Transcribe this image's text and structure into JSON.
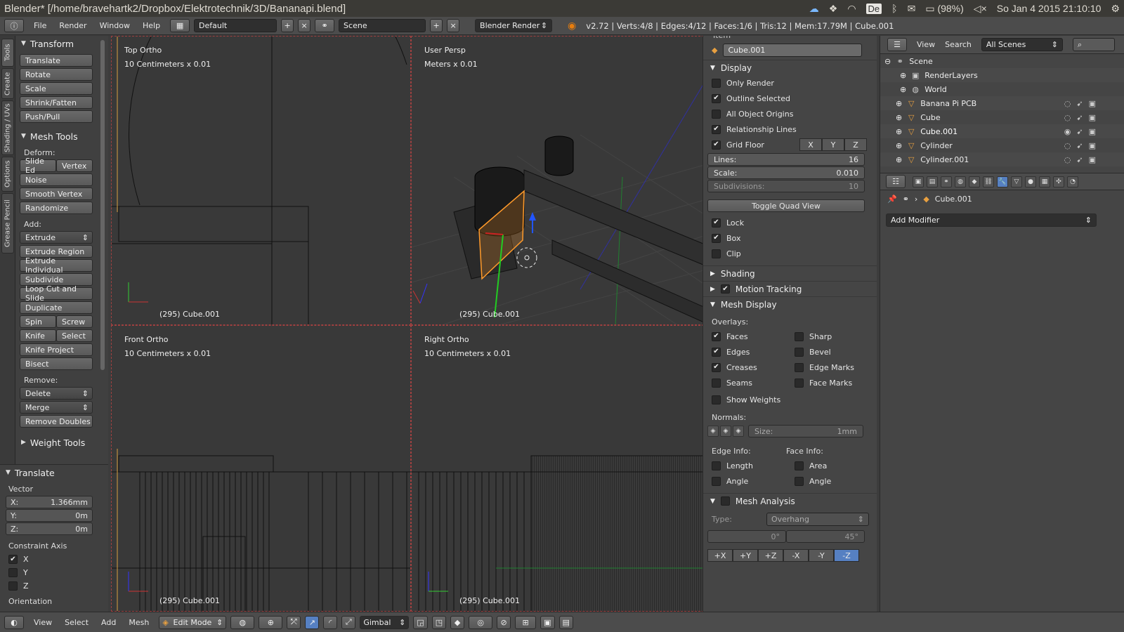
{
  "system": {
    "title": "Blender* [/home/bravehartk2/Dropbox/Elektrotechnik/3D/Bananapi.blend]",
    "keyboard": "De",
    "battery": "(98%)",
    "datetime": "So Jan 4 2015 21:10:10"
  },
  "info_header": {
    "menus": [
      "File",
      "Render",
      "Window",
      "Help"
    ],
    "layout": "Default",
    "scene": "Scene",
    "engine": "Blender Render",
    "stats": "v2.72 | Verts:4/8 | Edges:4/12 | Faces:1/6 | Tris:12 | Mem:17.79M | Cube.001"
  },
  "tool_tabs": [
    "Tools",
    "Create",
    "Shading / UVs",
    "Options",
    "Grease Pencil"
  ],
  "tools": {
    "transform_title": "Transform",
    "transform": [
      "Translate",
      "Rotate",
      "Scale",
      "Shrink/Fatten",
      "Push/Pull"
    ],
    "mesh_tools_title": "Mesh Tools",
    "deform_label": "Deform:",
    "slide_edge": "Slide Ed",
    "vertex": "Vertex",
    "deform": [
      "Noise",
      "Smooth Vertex",
      "Randomize"
    ],
    "add_label": "Add:",
    "extrude": "Extrude",
    "add": [
      "Extrude Region",
      "Extrude Individual",
      "Subdivide",
      "Loop Cut and Slide",
      "Duplicate"
    ],
    "spin": "Spin",
    "screw": "Screw",
    "knife": "Knife",
    "select": "Select",
    "add2": [
      "Knife Project",
      "Bisect"
    ],
    "remove_label": "Remove:",
    "delete": "Delete",
    "merge": "Merge",
    "remove_doubles": "Remove Doubles",
    "weight_tools": "Weight Tools"
  },
  "redo": {
    "title": "Translate",
    "vector_label": "Vector",
    "x": {
      "label": "X:",
      "value": "1.366mm"
    },
    "y": {
      "label": "Y:",
      "value": "0m"
    },
    "z": {
      "label": "Z:",
      "value": "0m"
    },
    "constraint_label": "Constraint Axis",
    "cx": "X",
    "cy": "Y",
    "cz": "Z",
    "orientation": "Orientation"
  },
  "viewports": {
    "top": {
      "name": "Top Ortho",
      "scale": "10 Centimeters x 0.01",
      "object": "(295) Cube.001"
    },
    "persp": {
      "name": "User Persp",
      "scale": "Meters x 0.01",
      "object": "(295) Cube.001"
    },
    "front": {
      "name": "Front Ortho",
      "scale": "10 Centimeters x 0.01",
      "object": "(295) Cube.001"
    },
    "right": {
      "name": "Right Ortho",
      "scale": "10 Centimeters x 0.01",
      "object": "(295) Cube.001"
    }
  },
  "npanel": {
    "item_title": "Item",
    "object_name": "Cube.001",
    "display_title": "Display",
    "only_render": "Only Render",
    "outline_selected": "Outline Selected",
    "all_object_origins": "All Object Origins",
    "relationship_lines": "Relationship Lines",
    "grid_floor": "Grid Floor",
    "x": "X",
    "y": "Y",
    "z": "Z",
    "lines_label": "Lines:",
    "lines_value": "16",
    "scale_label": "Scale:",
    "scale_value": "0.010",
    "subdiv_label": "Subdivisions:",
    "subdiv_value": "10",
    "toggle_quad": "Toggle Quad View",
    "lock": "Lock",
    "box": "Box",
    "clip": "Clip",
    "shading": "Shading",
    "motion_tracking": "Motion Tracking",
    "mesh_display": "Mesh Display",
    "overlays": "Overlays:",
    "faces": "Faces",
    "sharp": "Sharp",
    "edges": "Edges",
    "bevel": "Bevel",
    "creases": "Creases",
    "edge_marks": "Edge Marks",
    "seams": "Seams",
    "face_marks": "Face Marks",
    "show_weights": "Show Weights",
    "normals": "Normals:",
    "size_label": "Size:",
    "size_value": "1mm",
    "edge_info": "Edge Info:",
    "face_info": "Face Info:",
    "length": "Length",
    "area": "Area",
    "angle": "Angle",
    "angle2": "Angle",
    "mesh_analysis": "Mesh Analysis",
    "type_label": "Type:",
    "type_value": "Overhang",
    "min_angle": "0°",
    "max_angle": "45°",
    "axes": [
      "+X",
      "+Y",
      "+Z",
      "-X",
      "-Y",
      "-Z"
    ]
  },
  "outliner": {
    "view": "View",
    "search": "Search",
    "filter": "All Scenes",
    "rows": [
      "Scene",
      "RenderLayers",
      "World",
      "Banana Pi PCB",
      "Cube",
      "Cube.001",
      "Cylinder",
      "Cylinder.001"
    ]
  },
  "properties": {
    "object": "Cube.001",
    "add_modifier": "Add Modifier"
  },
  "bottom": {
    "menus": [
      "View",
      "Select",
      "Add",
      "Mesh"
    ],
    "mode": "Edit Mode",
    "orientation": "Gimbal"
  }
}
